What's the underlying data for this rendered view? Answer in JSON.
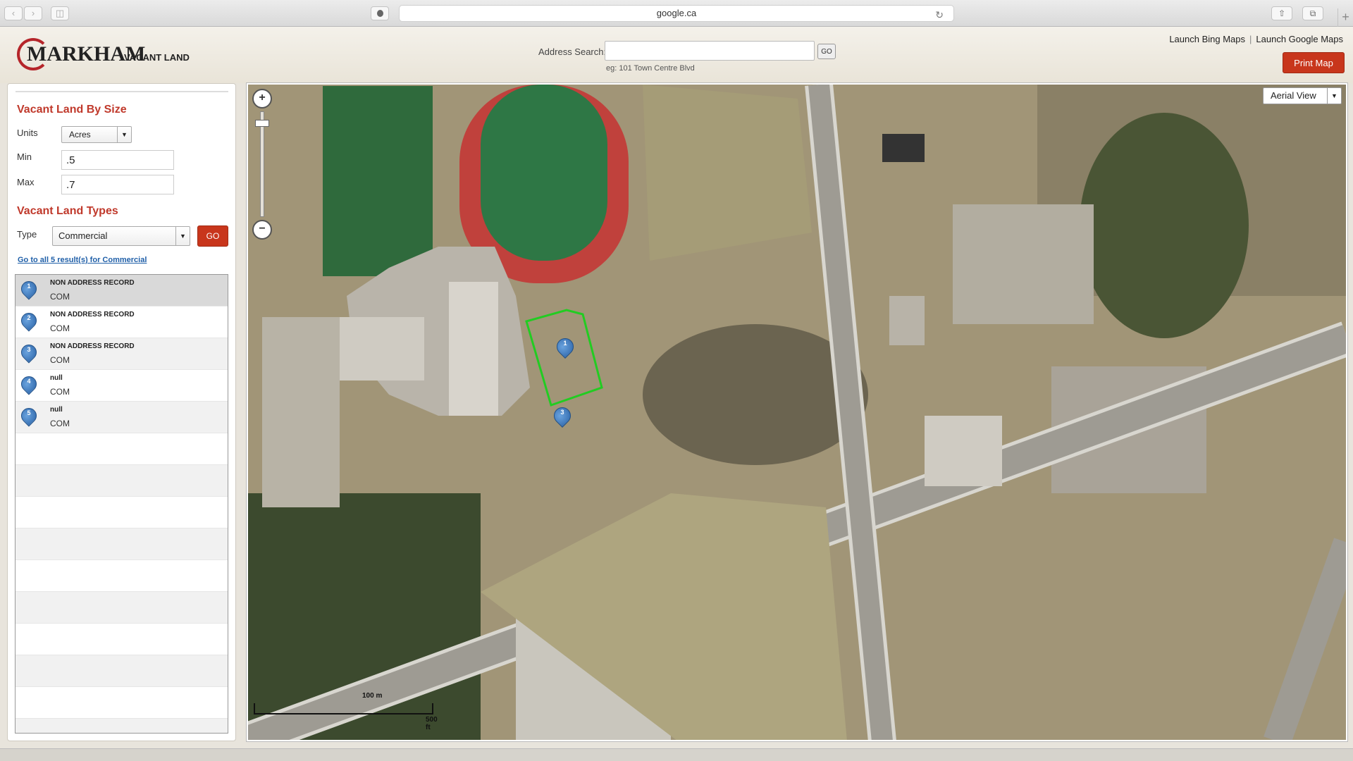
{
  "browser": {
    "url": "google.ca"
  },
  "header": {
    "logo_text": "MARKHAM",
    "logo_sub": "VACANT LAND",
    "address_label": "Address Search:",
    "address_value": "",
    "address_go": "GO",
    "address_hint": "eg: 101 Town Centre Blvd",
    "link_bing": "Launch Bing Maps",
    "link_google": "Launch Google Maps",
    "print_label": "Print Map"
  },
  "sidebar": {
    "size_title": "Vacant Land By Size",
    "units_label": "Units",
    "units_value": "Acres",
    "min_label": "Min",
    "min_value": ".5",
    "max_label": "Max",
    "max_value": ".7",
    "types_title": "Vacant Land Types",
    "type_label": "Type",
    "type_value": "Commercial",
    "go_label": "GO",
    "results_link": "Go to all 5 result(s) for Commercial",
    "results": [
      {
        "num": "1",
        "title": "NON ADDRESS RECORD",
        "sub": "COM"
      },
      {
        "num": "2",
        "title": "NON ADDRESS RECORD",
        "sub": "COM"
      },
      {
        "num": "3",
        "title": "NON ADDRESS RECORD",
        "sub": "COM"
      },
      {
        "num": "4",
        "title": "null",
        "sub": "COM"
      },
      {
        "num": "5",
        "title": "null",
        "sub": "COM"
      }
    ]
  },
  "map": {
    "view_value": "Aerial View",
    "zoom_in": "+",
    "zoom_out": "−",
    "scale_m": "100 m",
    "scale_ft": "500 ft",
    "pin1": "1",
    "pin3": "3",
    "parcel_color": "#22cc22"
  }
}
